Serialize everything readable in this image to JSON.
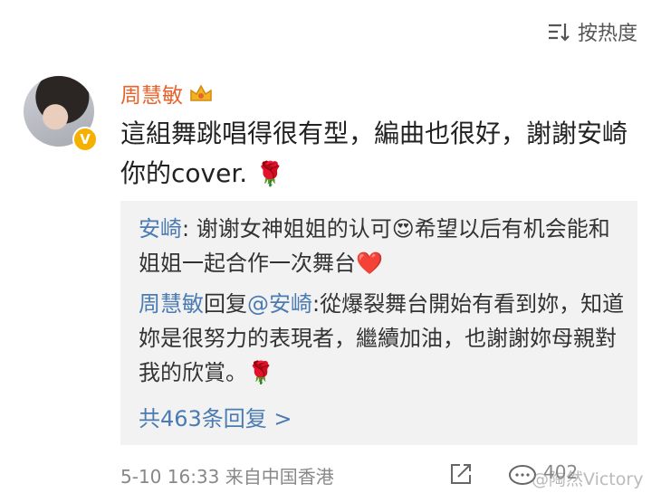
{
  "sort": {
    "label": "按热度",
    "icon": "sort-icon"
  },
  "post": {
    "author": "周慧敏",
    "author_badge_icon": "crown-icon",
    "verified_icon": "verified-v-icon",
    "verified_mark": "V",
    "text": "這組舞跳唱得很有型，編曲也很好，謝謝安崎你的cover.",
    "text_emoji": "🌹"
  },
  "replies": [
    {
      "author": "安崎",
      "sep": ": ",
      "text": "谢谢女神姐姐的认可",
      "emoji_mid": "😍",
      "text_after": "希望以后有机会能和姐姐一起合作一次舞台",
      "emoji_end": "❤️"
    },
    {
      "author": "周慧敏",
      "verb": "回复",
      "mention": "@安崎",
      "sep": ":",
      "text": "從爆裂舞台開始有看到妳，知道妳是很努力的表現者，繼續加油，也謝謝妳母親對我的欣賞。",
      "emoji_end": "🌹"
    }
  ],
  "more_replies": "共463条回复 >",
  "footer": {
    "time": "5-10 16:33",
    "source": "来自中国香港"
  },
  "actions": {
    "like_count": "402"
  },
  "watermark": "@陶然Victory",
  "colors": {
    "accent_name": "#e8632c",
    "link": "#4a7bb3",
    "reply_bg": "#f2f2f2"
  }
}
